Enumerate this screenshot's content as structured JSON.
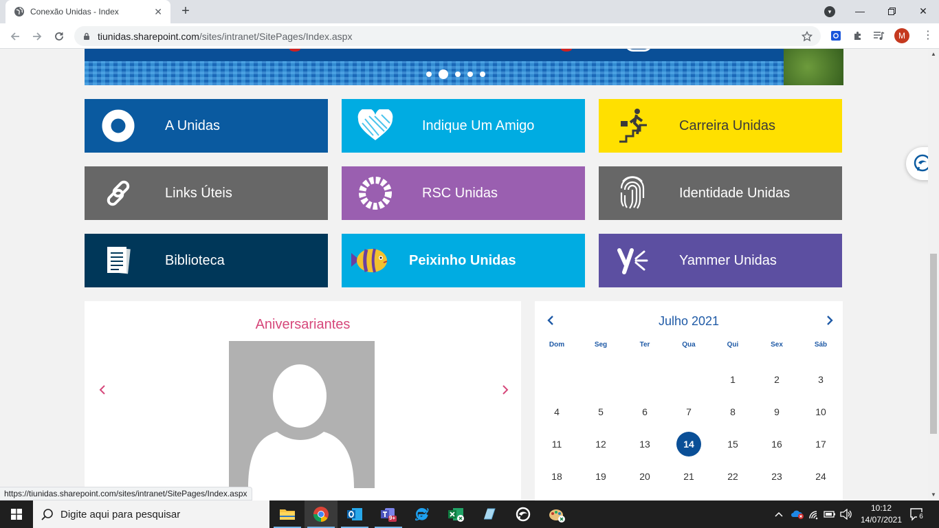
{
  "browser": {
    "tab_title": "Conexão Unidas - Index",
    "url_host": "tiunidas.sharepoint.com",
    "url_path": "/sites/intranet/SitePages/Index.aspx",
    "profile_initial": "M",
    "status_url": "https://tiunidas.sharepoint.com/sites/intranet/SitePages/Index.aspx"
  },
  "banner": {
    "slides": 5,
    "active_slide": 2
  },
  "tiles": [
    {
      "label": "A Unidas",
      "color": "#0a5aa0",
      "icon": "ring-icon"
    },
    {
      "label": "Indique Um Amigo",
      "color": "#00ace2",
      "icon": "heart-icon"
    },
    {
      "label": "Carreira Unidas",
      "color": "#ffe000",
      "icon": "career-stairs-icon"
    },
    {
      "label": "Links Úteis",
      "color": "#676767",
      "icon": "link-icon"
    },
    {
      "label": "RSC Unidas",
      "color": "#9a5fb0",
      "icon": "rsc-wreath-icon"
    },
    {
      "label": "Identidade Unidas",
      "color": "#676767",
      "icon": "fingerprint-icon"
    },
    {
      "label": "Biblioteca",
      "color": "#003759",
      "icon": "documents-icon"
    },
    {
      "label": "Peixinho Unidas",
      "color": "#00ace2",
      "icon": "fish-icon"
    },
    {
      "label": "Yammer Unidas",
      "color": "#5c4fa1",
      "icon": "yammer-icon"
    }
  ],
  "birthdays": {
    "title": "Aniversariantes"
  },
  "calendar": {
    "month_label": "Julho 2021",
    "weekdays": [
      "Dom",
      "Seg",
      "Ter",
      "Qua",
      "Qui",
      "Sex",
      "Sáb"
    ],
    "weeks": [
      [
        "",
        "",
        "",
        "",
        "1",
        "2",
        "3"
      ],
      [
        "4",
        "5",
        "6",
        "7",
        "8",
        "9",
        "10"
      ],
      [
        "11",
        "12",
        "13",
        "14",
        "15",
        "16",
        "17"
      ],
      [
        "18",
        "19",
        "20",
        "21",
        "22",
        "23",
        "24"
      ]
    ],
    "today": "14"
  },
  "taskbar": {
    "search_placeholder": "Digite aqui para pesquisar",
    "time": "10:12",
    "date": "14/07/2021",
    "teams_badge": "9+",
    "notification_count": "6"
  }
}
